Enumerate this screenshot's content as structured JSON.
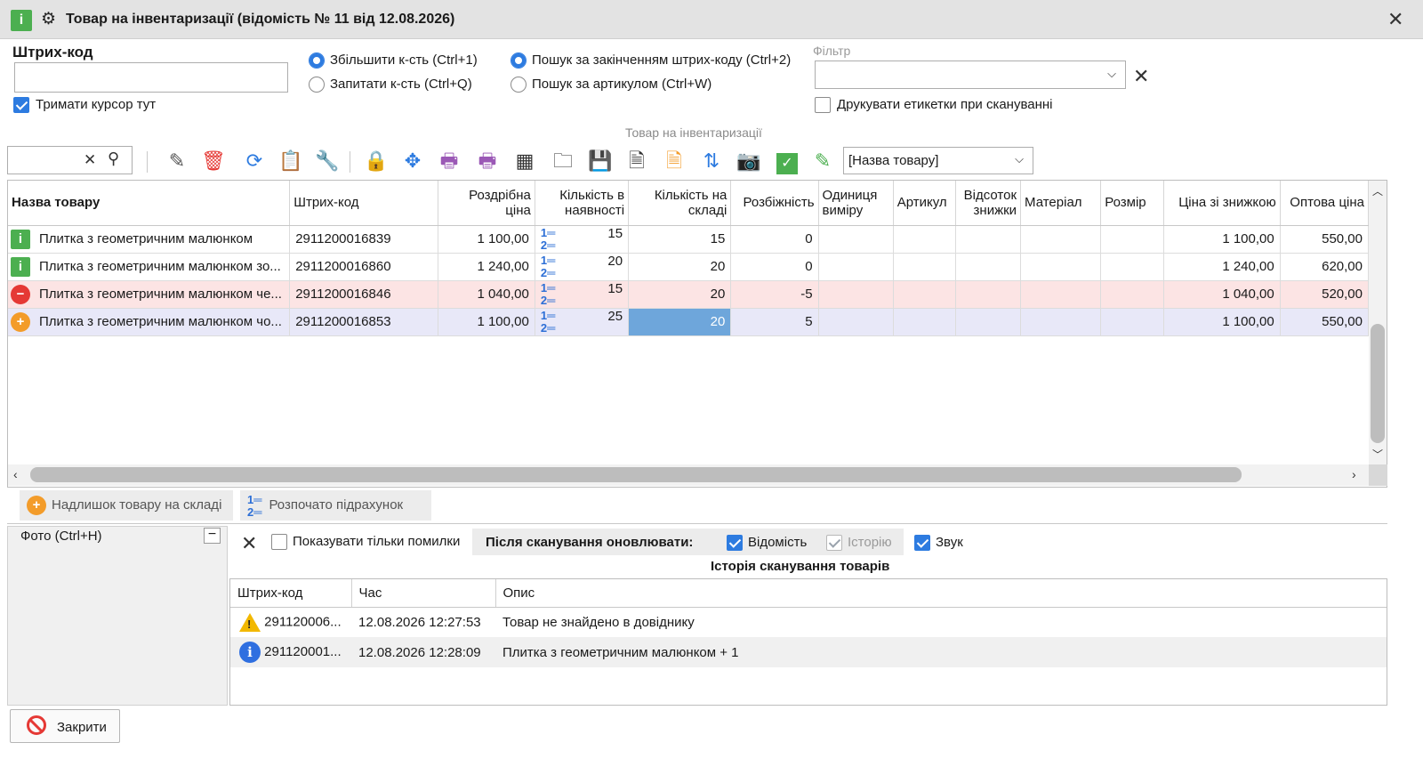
{
  "window": {
    "title": "Товар на інвентаризації (відомість № 11 від 12.08.2026)",
    "app_icon_glyph": "i"
  },
  "barcode_section": {
    "label": "Штрих-код",
    "input_value": "",
    "keep_cursor_label": "Тримати курсор тут",
    "keep_cursor_checked": true
  },
  "qty_mode": {
    "options": [
      {
        "label": "Збільшити к-сть (Ctrl+1)",
        "selected": true
      },
      {
        "label": "Запитати к-сть (Ctrl+Q)",
        "selected": false
      }
    ]
  },
  "search_mode": {
    "options": [
      {
        "label": "Пошук за закінченням штрих-коду (Ctrl+2)",
        "selected": true
      },
      {
        "label": "Пошук за артикулом (Ctrl+W)",
        "selected": false
      }
    ]
  },
  "filter": {
    "label": "Фільтр",
    "value": "",
    "print_labels_text": "Друкувати етикетки при скануванні",
    "print_labels_checked": false
  },
  "grid_caption": "Товар на інвентаризації",
  "toolbar": {
    "search_value": "",
    "sort_select_value": "[Назва товару]",
    "icons": [
      "clear-icon",
      "search-icon",
      "edit-icon",
      "delete-icon",
      "refresh-icon",
      "clipboard-icon",
      "wrench-icon",
      "lock-icon",
      "move-icon",
      "print-icon",
      "print-labels-icon",
      "calculator-icon",
      "folder-export-icon",
      "save-icon",
      "document-icon",
      "document-orange-icon",
      "sort-arrows-icon",
      "camera-icon",
      "check-icon",
      "highlight-pen-icon"
    ]
  },
  "grid": {
    "columns": [
      "Назва товару",
      "Штрих-код",
      "Роздрібна ціна",
      "Кількість в наявності",
      "Кількість на складі",
      "Розбіжність",
      "Одиниця виміру",
      "Артикул",
      "Відсоток знижки",
      "Матеріал",
      "Розмір",
      "Ціна зі знижкою",
      "Оптова ціна"
    ],
    "rows": [
      {
        "status": "ok",
        "name": "Плитка з геометричним малюнком",
        "barcode": "2911200016839",
        "retail": "1 100,00",
        "in_stock": "15",
        "on_shelf": "15",
        "diff": "0",
        "unit": "",
        "article": "",
        "discount": "",
        "material": "",
        "size": "",
        "discounted": "1 100,00",
        "wholesale": "550,00"
      },
      {
        "status": "ok",
        "name": "Плитка з геометричним малюнком зо...",
        "barcode": "2911200016860",
        "retail": "1 240,00",
        "in_stock": "20",
        "on_shelf": "20",
        "diff": "0",
        "unit": "",
        "article": "",
        "discount": "",
        "material": "",
        "size": "",
        "discounted": "1 240,00",
        "wholesale": "620,00"
      },
      {
        "status": "shortage",
        "name": "Плитка з геометричним малюнком че...",
        "barcode": "2911200016846",
        "retail": "1 040,00",
        "in_stock": "15",
        "on_shelf": "20",
        "diff": "-5",
        "unit": "",
        "article": "",
        "discount": "",
        "material": "",
        "size": "",
        "discounted": "1 040,00",
        "wholesale": "520,00"
      },
      {
        "status": "surplus",
        "name": "Плитка з геометричним малюнком чо...",
        "barcode": "2911200016853",
        "retail": "1 100,00",
        "in_stock": "25",
        "on_shelf": "20",
        "diff": "5",
        "unit": "",
        "article": "",
        "discount": "",
        "material": "",
        "size": "",
        "discounted": "1 100,00",
        "wholesale": "550,00"
      }
    ]
  },
  "legend": {
    "surplus": "Надлишок товару на складі",
    "started": "Розпочато підрахунок"
  },
  "photo_panel": {
    "label": "Фото (Ctrl+H)"
  },
  "history_controls": {
    "only_errors_label": "Показувати тільки помилки",
    "only_errors_checked": false,
    "after_scan_label": "Після сканування оновлювати:",
    "vidomist_label": "Відомість",
    "vidomist_checked": true,
    "history_label": "Історію",
    "history_checked": true,
    "sound_label": "Звук",
    "sound_checked": true
  },
  "history": {
    "title": "Історія сканування товарів",
    "columns": [
      "Штрих-код",
      "Час",
      "Опис"
    ],
    "rows": [
      {
        "type": "warning",
        "barcode": "291120006...",
        "time": "12.08.2026 12:27:53",
        "desc": "Товар не знайдено в довіднику"
      },
      {
        "type": "info",
        "barcode": "291120001...",
        "time": "12.08.2026 12:28:09",
        "desc": "Плитка з геометричним малюнком + 1"
      }
    ]
  },
  "footer": {
    "close_label": "Закрити"
  },
  "colors": {
    "accent": "#2d7be0",
    "ok": "#4caf50",
    "error": "#e53935",
    "surplus": "#f39c2a",
    "selected_cell": "#6ea6db"
  }
}
